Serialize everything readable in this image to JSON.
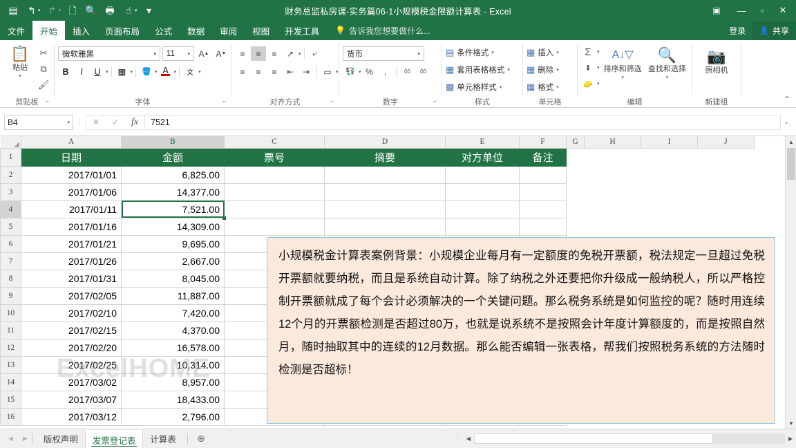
{
  "window": {
    "title": "财务总监私房课-实务篇06-1小规模税金限额计算表 - Excel",
    "ribbon_display_icon": "▣",
    "minimize_icon": "—",
    "maximize_icon": "▫",
    "close_icon": "✕"
  },
  "quick_access": [
    {
      "name": "save-icon",
      "glyph": "▤",
      "dim": false,
      "caret": false
    },
    {
      "name": "undo-icon",
      "glyph": "↰",
      "dim": false,
      "caret": true
    },
    {
      "name": "redo-icon",
      "glyph": "↱",
      "dim": true,
      "caret": true
    },
    {
      "name": "new-file-icon",
      "glyph": "🗋",
      "dim": false,
      "caret": false
    },
    {
      "name": "print-preview-icon",
      "glyph": "🔍",
      "dim": false,
      "caret": false
    },
    {
      "name": "quick-print-icon",
      "glyph": "🖶",
      "dim": false,
      "caret": false
    },
    {
      "name": "touch-mode-icon",
      "glyph": "☝",
      "dim": false,
      "caret": true
    },
    {
      "name": "customize-qat-icon",
      "glyph": "▾",
      "dim": false,
      "caret": false
    }
  ],
  "ribbon_tabs": [
    {
      "label": "文件",
      "active": false
    },
    {
      "label": "开始",
      "active": true
    },
    {
      "label": "插入",
      "active": false
    },
    {
      "label": "页面布局",
      "active": false
    },
    {
      "label": "公式",
      "active": false
    },
    {
      "label": "数据",
      "active": false
    },
    {
      "label": "审阅",
      "active": false
    },
    {
      "label": "视图",
      "active": false
    },
    {
      "label": "开发工具",
      "active": false
    }
  ],
  "tell_me": {
    "placeholder": "告诉我您想要做什么...",
    "icon": "💡"
  },
  "account": {
    "signin": "登录",
    "share": "共享",
    "share_icon": "👤"
  },
  "ribbon": {
    "clipboard": {
      "label": "剪贴板",
      "paste_label": "粘贴",
      "paste_icon": "📋",
      "cut_icon": "✂",
      "copy_icon": "⧉",
      "format_painter_icon": "🖌"
    },
    "font": {
      "label": "字体",
      "font_name": "微软雅黑",
      "font_size": "11",
      "grow_font": "A",
      "shrink_font": "A",
      "bold": "B",
      "italic": "I",
      "underline": "U",
      "border_icon": "▦",
      "fill_icon": "🪣",
      "color_icon": "A",
      "phonetic_icon": "文"
    },
    "alignment": {
      "label": "对齐方式",
      "top_align": "≡",
      "middle_align": "≡",
      "bottom_align": "≡",
      "orientation_icon": "↗",
      "wrap_text_icon": "⤶",
      "align_left": "≡",
      "align_center": "≡",
      "align_right": "≡",
      "decrease_indent": "⇤",
      "increase_indent": "⇥",
      "merge_center_icon": "▭"
    },
    "number": {
      "label": "数字",
      "format": "货币",
      "accounting_icon": "💱",
      "percent": "%",
      "comma": ",",
      "increase_decimal": ".00",
      "decrease_decimal": ".00"
    },
    "styles": {
      "label": "样式",
      "items": [
        {
          "label": "条件格式",
          "icon": "▤"
        },
        {
          "label": "套用表格格式",
          "icon": "▦"
        },
        {
          "label": "单元格样式",
          "icon": "▩"
        }
      ]
    },
    "cells": {
      "label": "单元格",
      "items": [
        {
          "label": "插入",
          "icon": "▦"
        },
        {
          "label": "删除",
          "icon": "▦"
        },
        {
          "label": "格式",
          "icon": "▦"
        }
      ]
    },
    "editing": {
      "label": "编辑",
      "autosum_icon": "Σ",
      "fill_icon": "⬇",
      "clear_icon": "🧽",
      "sort_filter_label": "排序和筛选",
      "sort_filter_icon": "A\nZ",
      "find_select_label": "查找和选择",
      "find_select_icon": "🔍"
    },
    "newgroup": {
      "label": "新建组",
      "camera_label": "照相机",
      "camera_icon": "📷"
    },
    "collapse_icon": "⌃"
  },
  "formula_bar": {
    "name_box": "B4",
    "cancel_icon": "✕",
    "enter_icon": "✓",
    "fx_icon": "fx",
    "value": "7521",
    "expand_icon": "⌄"
  },
  "sheet": {
    "columns": [
      "A",
      "B",
      "C",
      "D",
      "E",
      "F",
      "G",
      "H",
      "I",
      "J"
    ],
    "selected_column": "B",
    "selected_row": 4,
    "headers": [
      "日期",
      "金额",
      "票号",
      "摘要",
      "对方单位",
      "备注"
    ],
    "rows": [
      {
        "n": 2,
        "date": "2017/01/01",
        "amount": "6,825.00"
      },
      {
        "n": 3,
        "date": "2017/01/06",
        "amount": "14,377.00"
      },
      {
        "n": 4,
        "date": "2017/01/11",
        "amount": "7,521.00"
      },
      {
        "n": 5,
        "date": "2017/01/16",
        "amount": "14,309.00"
      },
      {
        "n": 6,
        "date": "2017/01/21",
        "amount": "9,695.00"
      },
      {
        "n": 7,
        "date": "2017/01/26",
        "amount": "2,667.00"
      },
      {
        "n": 8,
        "date": "2017/01/31",
        "amount": "8,045.00"
      },
      {
        "n": 9,
        "date": "2017/02/05",
        "amount": "11,887.00"
      },
      {
        "n": 10,
        "date": "2017/02/10",
        "amount": "7,420.00"
      },
      {
        "n": 11,
        "date": "2017/02/15",
        "amount": "4,370.00"
      },
      {
        "n": 12,
        "date": "2017/02/20",
        "amount": "16,578.00"
      },
      {
        "n": 13,
        "date": "2017/02/25",
        "amount": "10,314.00"
      },
      {
        "n": 14,
        "date": "2017/03/02",
        "amount": "8,957.00"
      },
      {
        "n": 15,
        "date": "2017/03/07",
        "amount": "18,433.00"
      },
      {
        "n": 16,
        "date": "2017/03/12",
        "amount": "2,796.00"
      }
    ],
    "watermark": "ExcelHOME"
  },
  "callout": {
    "text": "小规模税金计算表案例背景：小规模企业每月有一定额度的免税开票额，税法规定一旦超过免税开票额就要纳税，而且是系统自动计算。除了纳税之外还要把你升级成一般纳税人，所以严格控制开票额就成了每个会计必须解决的一个关键问题。那么税务系统是如何监控的呢？随时用连续12个月的开票额检测是否超过80万，也就是说系统不是按照会计年度计算额度的，而是按照自然月，随时抽取其中的连续的12月数据。那么能否编辑一张表格，帮我们按照税务系统的方法随时检测是否超标！"
  },
  "sheet_tabs": {
    "prev_icon": "◀",
    "next_icon": "▶",
    "tabs": [
      {
        "label": "版权声明",
        "active": false
      },
      {
        "label": "发票登记表",
        "active": true
      },
      {
        "label": "计算表",
        "active": false
      }
    ],
    "add_icon": "⊕"
  },
  "scrollbars": {
    "v_up": "▲",
    "v_down": "▼",
    "h_left": "◀",
    "h_right": "▶"
  },
  "colors": {
    "brand_green": "#217346",
    "header_green": "#217346",
    "callout_bg": "#fbe9dc",
    "callout_border": "#8cc6e6"
  }
}
